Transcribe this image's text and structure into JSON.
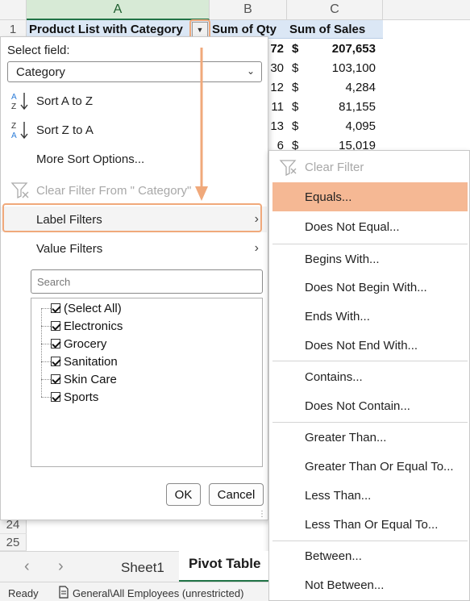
{
  "sheet": {
    "columns": [
      "A",
      "B",
      "C"
    ],
    "rows": [
      "1",
      "24",
      "25"
    ],
    "header": {
      "col_a": "Product List with Category",
      "col_b": "Sum of Qty",
      "col_c": "Sum of Sales"
    },
    "qty_values": [
      "72",
      "30",
      "12",
      "11",
      "13",
      "6"
    ],
    "currency_symbol": "$",
    "sales_values": [
      "207,653",
      "103,100",
      "4,284",
      "81,155",
      "4,095",
      "15,019"
    ]
  },
  "panel": {
    "select_field_label": "Select field:",
    "select_field_value": "Category",
    "menu": {
      "sort_az": "Sort A to Z",
      "sort_za": "Sort Z to A",
      "more_sort": "More Sort Options...",
      "clear_filter_from": "Clear Filter From \" Category\"",
      "label_filters": "Label Filters",
      "value_filters": "Value Filters"
    },
    "search_placeholder": "Search",
    "items": [
      "(Select All)",
      "Electronics",
      "Grocery",
      "Sanitation",
      "Skin Care",
      "Sports"
    ],
    "ok": "OK",
    "cancel": "Cancel"
  },
  "submenu": {
    "clear_filter": "Clear Filter",
    "items": [
      "Equals...",
      "Does Not Equal...",
      "Begins With...",
      "Does Not Begin With...",
      "Ends With...",
      "Does Not End With...",
      "Contains...",
      "Does Not Contain...",
      "Greater Than...",
      "Greater Than Or Equal To...",
      "Less Than...",
      "Less Than Or Equal To...",
      "Between...",
      "Not Between..."
    ]
  },
  "tabs": {
    "sheet1": "Sheet1",
    "pivot": "Pivot Table"
  },
  "status": {
    "ready": "Ready",
    "sensitivity": "General\\All Employees (unrestricted)"
  },
  "colors": {
    "accent": "#f0a97b",
    "active_item": "#f5b894",
    "header_fill": "#dbe7f5",
    "excel_green": "#217346"
  }
}
